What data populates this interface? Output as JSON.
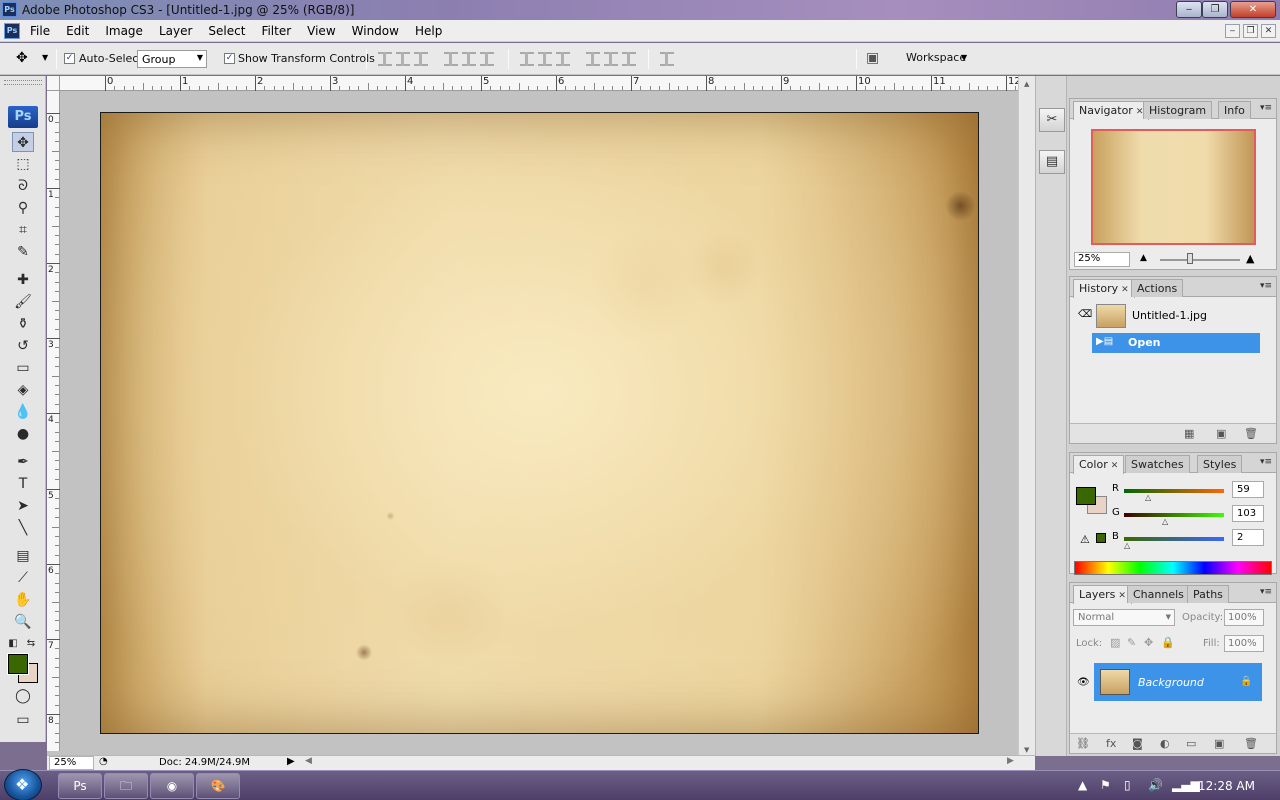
{
  "window": {
    "title": "Adobe Photoshop CS3 - [Untitled-1.jpg @ 25% (RGB/8)]",
    "app_icon": "Ps"
  },
  "menu": [
    "File",
    "Edit",
    "Image",
    "Layer",
    "Select",
    "Filter",
    "View",
    "Window",
    "Help"
  ],
  "options": {
    "auto_select_label": "Auto-Select:",
    "auto_select_value": "Group",
    "show_transform_label": "Show Transform Controls",
    "workspace_label": "Workspace"
  },
  "toolbox": {
    "logo": "Ps"
  },
  "ruler": {
    "h_labels": [
      "0",
      "1",
      "2",
      "3",
      "4",
      "5",
      "6",
      "7",
      "8",
      "9",
      "10",
      "11",
      "12"
    ],
    "v_labels": [
      "0",
      "1",
      "2",
      "3",
      "4",
      "5",
      "6",
      "7",
      "8"
    ]
  },
  "status": {
    "zoom": "25%",
    "doc": "Doc: 24.9M/24.9M"
  },
  "navigator": {
    "tabs": [
      "Navigator",
      "Histogram",
      "Info"
    ],
    "zoom": "25%"
  },
  "history": {
    "tabs": [
      "History",
      "Actions"
    ],
    "items": [
      {
        "label": "Untitled-1.jpg"
      },
      {
        "label": "Open"
      }
    ]
  },
  "color": {
    "tabs": [
      "Color",
      "Swatches",
      "Styles"
    ],
    "fg": "#3b6702",
    "bg": "#e9d3c6",
    "channels": [
      {
        "label": "R",
        "value": "59"
      },
      {
        "label": "G",
        "value": "103"
      },
      {
        "label": "B",
        "value": "2"
      }
    ]
  },
  "layers": {
    "tabs": [
      "Layers",
      "Channels",
      "Paths"
    ],
    "blend_mode": "Normal",
    "opacity_label": "Opacity:",
    "opacity": "100%",
    "lock_label": "Lock:",
    "fill_label": "Fill:",
    "fill": "100%",
    "items": [
      {
        "name": "Background"
      }
    ]
  },
  "taskbar": {
    "clock": "12:28 AM",
    "apps": [
      "photoshop-icon",
      "explorer-icon",
      "firefox-icon",
      "paint-icon"
    ]
  }
}
